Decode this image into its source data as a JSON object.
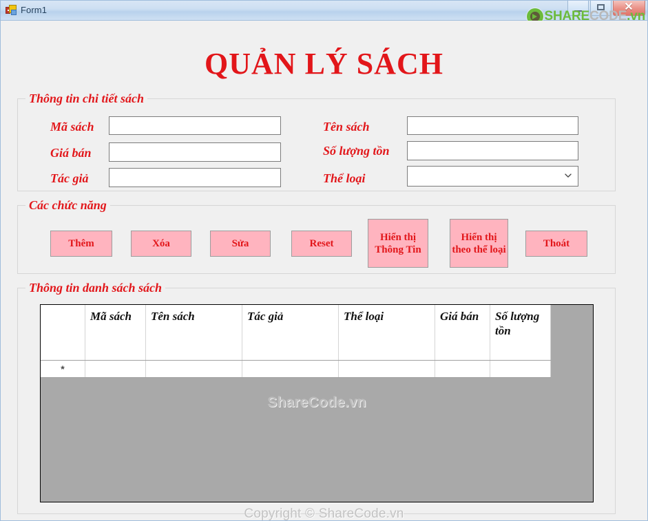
{
  "window": {
    "title": "Form1",
    "app_icon": "form-designer-icon",
    "controls": {
      "minimize": "minimize-button",
      "maximize": "maximize-button",
      "close": "close-button",
      "close_glyph": "✕"
    },
    "watermark": {
      "part1": "SHARE",
      "part2": "CODE",
      "part3": ".vn",
      "logo_color": "#6cbb3c",
      "mid_color": "#b9b9b9"
    }
  },
  "page": {
    "title": "QUẢN LÝ SÁCH",
    "title_color": "#e2161a"
  },
  "detail_group": {
    "title": "Thông tin chi tiết sách",
    "fields": [
      {
        "label": "Mã sách",
        "value": "",
        "placeholder": ""
      },
      {
        "label": "Giá bán",
        "value": "",
        "placeholder": ""
      },
      {
        "label": "Tác giả",
        "value": "",
        "placeholder": ""
      },
      {
        "label": "Tên sách",
        "value": "",
        "placeholder": ""
      },
      {
        "label": "Số lượng tồn",
        "value": "",
        "placeholder": ""
      },
      {
        "label": "Thể loại",
        "value": "",
        "placeholder": ""
      }
    ]
  },
  "functions_group": {
    "title": "Các chức năng",
    "buttons": [
      {
        "label": "Thêm"
      },
      {
        "label": "Xóa"
      },
      {
        "label": "Sửa"
      },
      {
        "label": "Reset"
      },
      {
        "label": "Hiển thị Thông Tin"
      },
      {
        "label": "Hiển thị theo thể loại"
      },
      {
        "label": "Thoát"
      }
    ],
    "button_fill": "#ffb4bf",
    "button_text_color": "#e2161a"
  },
  "list_group": {
    "title": "Thông tin danh sách sách",
    "grid": {
      "row_header_new": "*",
      "columns": [
        "Mã sách",
        "Tên sách",
        "Tác giả",
        "Thể loại",
        "Giá bán",
        "Số lượng tồn"
      ],
      "rows": [
        {
          "cells": [
            "",
            "",
            "",
            "",
            "",
            ""
          ]
        }
      ],
      "empty_background": "#a9a9a9",
      "watermark": "ShareCode.vn"
    }
  },
  "footer": {
    "copyright": "Copyright © ShareCode.vn"
  }
}
